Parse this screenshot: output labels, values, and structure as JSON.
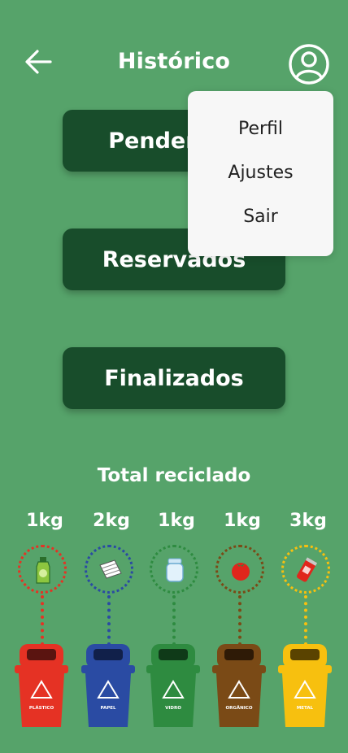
{
  "header": {
    "title": "Histórico"
  },
  "buttons": {
    "pendentes": "Pendentes",
    "reservados": "Reservados",
    "finalizados": "Finalizados"
  },
  "menu": {
    "items": [
      "Perfil",
      "Ajustes",
      "Sair"
    ]
  },
  "total": {
    "title": "Total reciclado",
    "bins": [
      {
        "weight": "1kg",
        "label": "PLÁSTICO",
        "icon": "bottle-icon",
        "color": "#e53224"
      },
      {
        "weight": "2kg",
        "label": "PAPEL",
        "icon": "paper-icon",
        "color": "#2a4ba3"
      },
      {
        "weight": "1kg",
        "label": "VIDRO",
        "icon": "jar-icon",
        "color": "#2e8b40"
      },
      {
        "weight": "1kg",
        "label": "ORGÂNICO",
        "icon": "tomato-icon",
        "color": "#7a4a16"
      },
      {
        "weight": "3kg",
        "label": "METAL",
        "icon": "can-icon",
        "color": "#f7c00f"
      }
    ]
  },
  "colors": {
    "background": "#56a36a",
    "button": "#184d2b",
    "menu": "#f7f7f7"
  }
}
